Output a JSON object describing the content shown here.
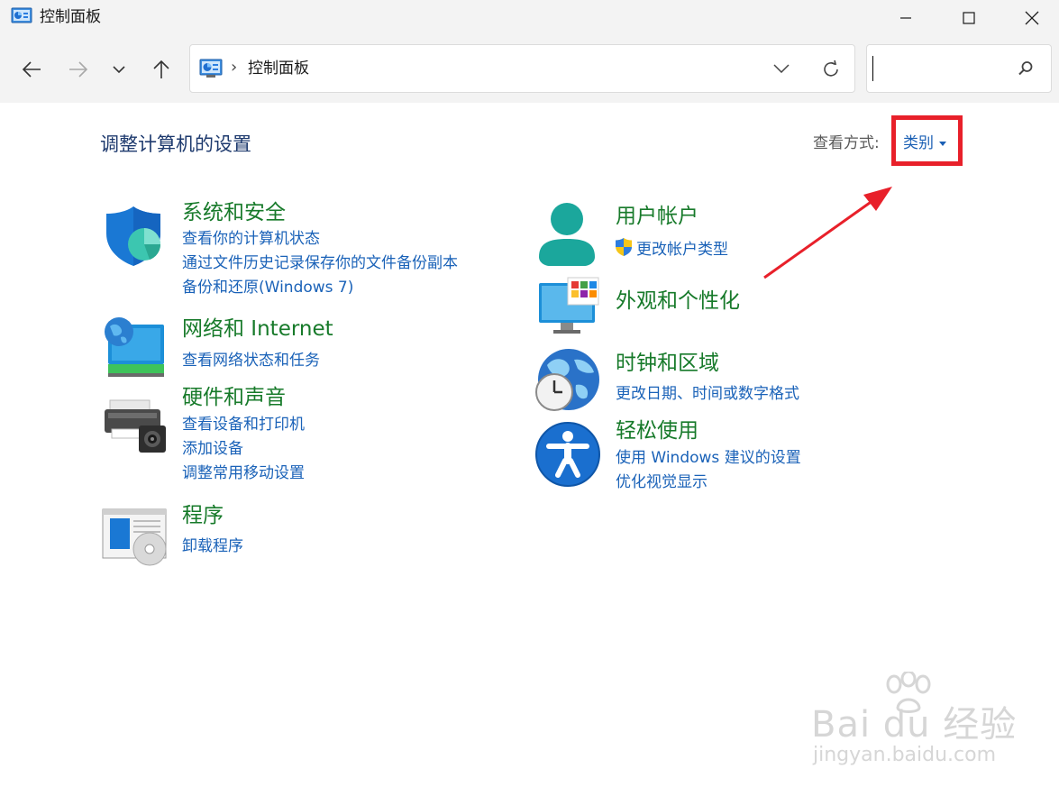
{
  "window": {
    "title": "控制面板"
  },
  "address": {
    "separator": "›",
    "path": "控制面板"
  },
  "search": {
    "placeholder": ""
  },
  "content": {
    "page_title": "调整计算机的设置",
    "view_by_label": "查看方式:",
    "view_by_value": "类别"
  },
  "categories": [
    {
      "id": "system-security",
      "title": "系统和安全",
      "icon": "shield-icon",
      "links": [
        "查看你的计算机状态",
        "通过文件历史记录保存你的文件备份副本",
        "备份和还原(Windows 7)"
      ]
    },
    {
      "id": "network",
      "title": "网络和 Internet",
      "icon": "network-globe-icon",
      "links": [
        "查看网络状态和任务"
      ]
    },
    {
      "id": "hardware",
      "title": "硬件和声音",
      "icon": "printer-icon",
      "links": [
        "查看设备和打印机",
        "添加设备",
        "调整常用移动设置"
      ]
    },
    {
      "id": "programs",
      "title": "程序",
      "icon": "programs-disc-icon",
      "links": [
        "卸载程序"
      ]
    },
    {
      "id": "user-accounts",
      "title": "用户帐户",
      "icon": "user-icon",
      "links": [
        "更改帐户类型"
      ]
    },
    {
      "id": "appearance",
      "title": "外观和个性化",
      "icon": "monitor-palette-icon",
      "links": []
    },
    {
      "id": "clock-region",
      "title": "时钟和区域",
      "icon": "globe-clock-icon",
      "links": [
        "更改日期、时间或数字格式"
      ]
    },
    {
      "id": "ease-of-access",
      "title": "轻松使用",
      "icon": "accessibility-icon",
      "links": [
        "使用 Windows 建议的设置",
        "优化视觉显示"
      ]
    }
  ],
  "watermark": {
    "brand": "Bai du 经验",
    "url": "jingyan.baidu.com"
  },
  "colors": {
    "category_title": "#177a2a",
    "link": "#1a62b8",
    "page_title": "#1e3a6e",
    "highlight": "#e8202a"
  }
}
